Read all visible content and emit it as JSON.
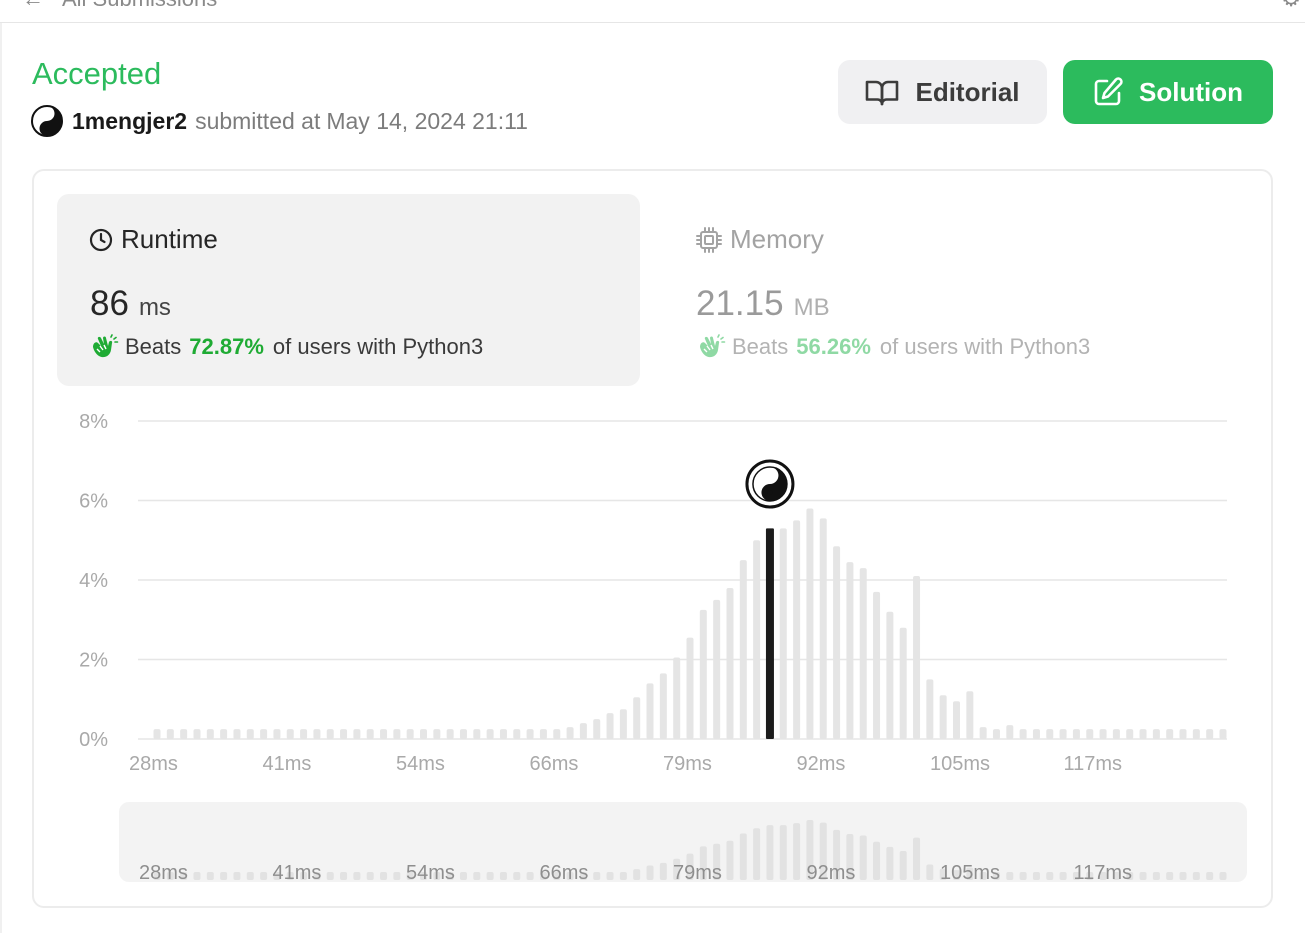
{
  "topbar": {
    "back_icon": "arrow-left-icon",
    "breadcrumb": "All Submissions"
  },
  "submission": {
    "status": "Accepted",
    "username": "1mengjer2",
    "submitted_text": "submitted at",
    "date": "May 14, 2024 21:11",
    "status_color": "#2cbb5d"
  },
  "buttons": {
    "editorial_label": "Editorial",
    "solution_label": "Solution",
    "editorial_icon": "book-open-icon",
    "solution_icon": "edit-icon"
  },
  "runtime": {
    "title": "Runtime",
    "value": "86",
    "unit": "ms",
    "beats_label": "Beats",
    "beats_pct": "72.87%",
    "beats_suffix": "of users with Python3"
  },
  "memory": {
    "title": "Memory",
    "value": "21.15",
    "unit": "MB",
    "beats_label": "Beats",
    "beats_pct": "56.26%",
    "beats_suffix": "of users with Python3"
  },
  "chart_data": {
    "type": "bar",
    "x_tick_labels": [
      "28ms",
      "41ms",
      "54ms",
      "66ms",
      "79ms",
      "92ms",
      "105ms",
      "117ms"
    ],
    "y_tick_labels": [
      "0%",
      "2%",
      "4%",
      "6%",
      "8%"
    ],
    "ylim": [
      0,
      8
    ],
    "grid": true,
    "highlight_index": 46,
    "values": [
      0.25,
      0.25,
      0.25,
      0.25,
      0.25,
      0.25,
      0.25,
      0.25,
      0.25,
      0.25,
      0.25,
      0.25,
      0.25,
      0.25,
      0.25,
      0.25,
      0.25,
      0.25,
      0.25,
      0.25,
      0.25,
      0.25,
      0.25,
      0.25,
      0.25,
      0.25,
      0.25,
      0.25,
      0.25,
      0.25,
      0.25,
      0.3,
      0.4,
      0.5,
      0.65,
      0.75,
      1.05,
      1.4,
      1.65,
      2.05,
      2.55,
      3.25,
      3.5,
      3.8,
      4.5,
      5.0,
      5.3,
      5.3,
      5.5,
      5.8,
      5.55,
      4.85,
      4.45,
      4.3,
      3.7,
      3.2,
      2.8,
      4.1,
      1.5,
      1.1,
      0.95,
      1.2,
      0.3,
      0.25,
      0.35,
      0.25,
      0.25,
      0.25,
      0.25,
      0.25,
      0.25,
      0.25,
      0.25,
      0.25,
      0.25,
      0.25,
      0.25,
      0.25,
      0.25,
      0.25,
      0.25
    ]
  },
  "colors": {
    "accent_green": "#2cbb5d",
    "beats_green": "#1fab34",
    "bar_gray": "#e5e5e5",
    "highlight_bar": "#1c1c1c"
  }
}
